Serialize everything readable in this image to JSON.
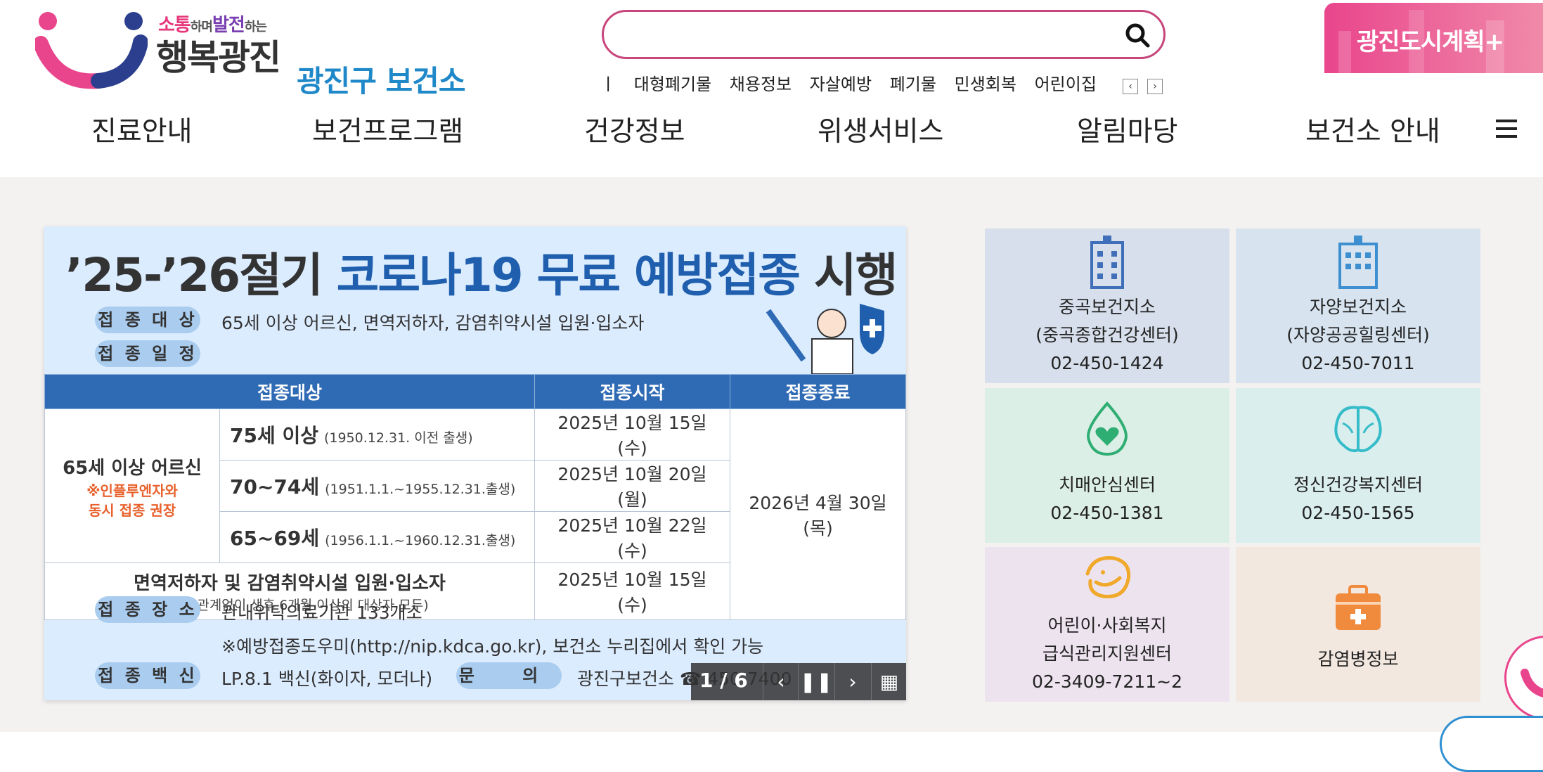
{
  "header": {
    "logo_slogan": [
      "소통",
      "하며",
      "발전",
      "하는"
    ],
    "logo_main": "행복광진",
    "logo_sub": "광진구 보건소",
    "search_value": "",
    "keywords": [
      "ㅣ",
      "대형폐기물",
      "채용정보",
      "자살예방",
      "폐기물",
      "민생회복",
      "어린이집"
    ],
    "banner_label": "광진도시계획+"
  },
  "nav": {
    "items": [
      "진료안내",
      "보건프로그램",
      "건강정보",
      "위생서비스",
      "알림마당",
      "보건소 안내"
    ]
  },
  "slide": {
    "title_prefix": "’25-’26절기 ",
    "title_highlight": "코로나19 무료 예방접종",
    "title_suffix": " 시행",
    "target_label": "접 종 대 상",
    "target_text": "65세 이상 어르신, 면역저하자, 감염취약시설 입원·입소자",
    "schedule_label": "접 종 일 정",
    "table_headers": [
      "접종대상",
      "접종시작",
      "접종종료"
    ],
    "group_elderly": "65세 이상 어르신",
    "group_elderly_note": [
      "※인플루엔자와",
      "동시 접종 권장"
    ],
    "rows": [
      {
        "age": "75세 이상",
        "birth": "(1950.12.31. 이전 출생)",
        "start": "2025년 10월 15일(수)"
      },
      {
        "age": "70~74세",
        "birth": "(1951.1.1.~1955.12.31.출생)",
        "start": "2025년 10월 20일(월)"
      },
      {
        "age": "65~69세",
        "birth": "(1956.1.1.~1960.12.31.출생)",
        "start": "2025년 10월 22일(수)"
      }
    ],
    "end_date": "2026년 4월 30일(목)",
    "immuno_group": "면역저하자 및 감염취약시설 입원·입소자",
    "immuno_note": "(연령과 관계없이 생후 6개월 이상의 대상자 모두)",
    "immuno_start": "2025년 10월 15일(수)",
    "place_label": "접 종 장 소",
    "place_text": "관내위탁의료기관 133개소",
    "place_note": "※예방접종도우미(http://nip.kdca.go.kr), 보건소 누리집에서 확인 가능",
    "vaccine_label": "접 종 백 신",
    "vaccine_text": "LP.8.1 백신(화이자, 모더나)",
    "contact_label": "문 의",
    "contact_text": "광진구보건소 ☎ 450-7400",
    "counter": "1 / 6"
  },
  "cards": [
    {
      "name": [
        "중곡보건지소",
        "(중곡종합건강센터)",
        "02-450-1424"
      ],
      "bg": "#d6dfeb",
      "icon": "hospital-icon"
    },
    {
      "name": [
        "자양보건지소",
        "(자양공공힐링센터)",
        "02-450-7011"
      ],
      "bg": "#d7e4f0",
      "icon": "hospital-icon"
    },
    {
      "name": [
        "치매안심센터",
        "02-450-1381"
      ],
      "bg": "#dcefe6",
      "icon": "heart-drop-icon"
    },
    {
      "name": [
        "정신건강복지센터",
        "02-450-1565"
      ],
      "bg": "#dbeeee",
      "icon": "brain-icon"
    },
    {
      "name": [
        "어린이·사회복지",
        "급식관리지원센터",
        "02-3409-7211~2"
      ],
      "bg": "#ede3ef",
      "icon": "smile-icon"
    },
    {
      "name": [
        "감염병정보"
      ],
      "bg": "#f3e8e0",
      "icon": "first-aid-icon"
    }
  ],
  "colors": {
    "accent_pink": "#e9458c",
    "brand_blue": "#1f88c9",
    "table_header": "#2f6ab4"
  }
}
